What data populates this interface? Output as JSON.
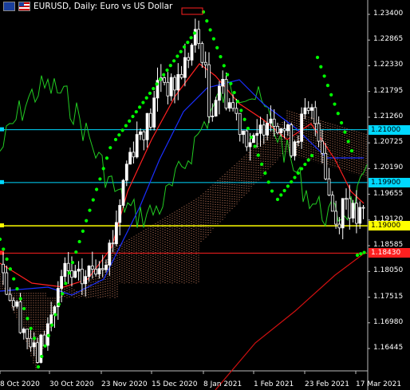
{
  "header": {
    "title": "EURUSD, Daily:  Euro vs US Dollar",
    "flag_left_icon": "eu-flag-icon",
    "flag_right_icon": "us-flag-icon"
  },
  "price_axis": [
    "1.23400",
    "1.22865",
    "1.22330",
    "1.21795",
    "1.21260",
    "1.20725",
    "1.20190",
    "1.19655",
    "1.19120",
    "1.18585",
    "1.18050",
    "1.17515",
    "1.16980",
    "1.16445"
  ],
  "time_axis": [
    "8 Oct 2020",
    "30 Oct 2020",
    "23 Nov 2020",
    "15 Dec 2020",
    "8 Jan 2021",
    "1 Feb 2021",
    "23 Feb 2021",
    "17 Mar 2021"
  ],
  "price_labels": [
    {
      "text": "1.21000",
      "color": "#00d8ff",
      "text_color": "#000",
      "value": 1.21
    },
    {
      "text": "1.19900",
      "color": "#00d8ff",
      "text_color": "#000",
      "value": 1.199
    },
    {
      "text": "1.19000",
      "color": "#ffff00",
      "text_color": "#000",
      "value": 1.19
    },
    {
      "text": "1.18430",
      "color": "#ff2020",
      "text_color": "#fff",
      "value": 1.1843
    }
  ],
  "colors": {
    "background": "#000000",
    "bull_candle": "#ffffff",
    "bear_candle": "#ffffff",
    "parabolic_sar": "#00ff00",
    "rsi_line": "#00cc00",
    "ma_fast": "#ff0000",
    "ma_slow": "#0000ff",
    "cloud": "#ffa07a"
  }
}
